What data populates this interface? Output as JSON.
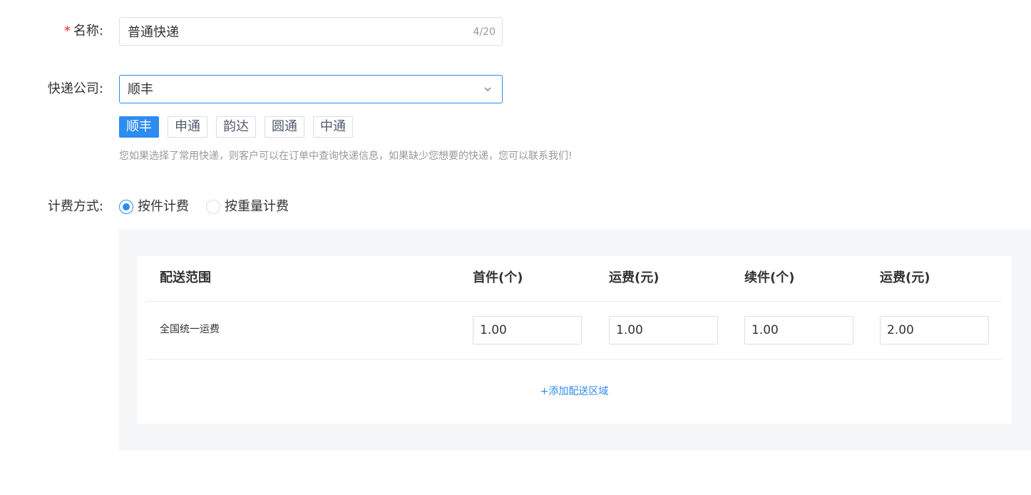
{
  "form": {
    "name": {
      "label": "名称:",
      "required_mark": "*",
      "value": "普通快递",
      "count": "4/20"
    },
    "company": {
      "label": "快递公司:",
      "selected": "顺丰",
      "tags": [
        {
          "label": "顺丰",
          "active": true
        },
        {
          "label": "申通",
          "active": false
        },
        {
          "label": "韵达",
          "active": false
        },
        {
          "label": "圆通",
          "active": false
        },
        {
          "label": "中通",
          "active": false
        }
      ],
      "hint": "您如果选择了常用快递，则客户可以在订单中查询快递信息，如果缺少您想要的快递，您可以联系我们!"
    },
    "billing": {
      "label": "计费方式:",
      "options": [
        {
          "label": "按件计费",
          "checked": true
        },
        {
          "label": "按重量计费",
          "checked": false
        }
      ]
    }
  },
  "fee_table": {
    "headers": [
      "配送范围",
      "首件(个)",
      "运费(元)",
      "续件(个)",
      "运费(元)"
    ],
    "rows": [
      {
        "region": "全国统一运费",
        "first_count": "1.00",
        "first_fee": "1.00",
        "extra_count": "1.00",
        "extra_fee": "2.00"
      }
    ],
    "add_region": "+添加配送区域"
  },
  "colors": {
    "primary": "#2d8cf0",
    "required": "#f5222d",
    "panel_bg": "#f5f6f8"
  }
}
